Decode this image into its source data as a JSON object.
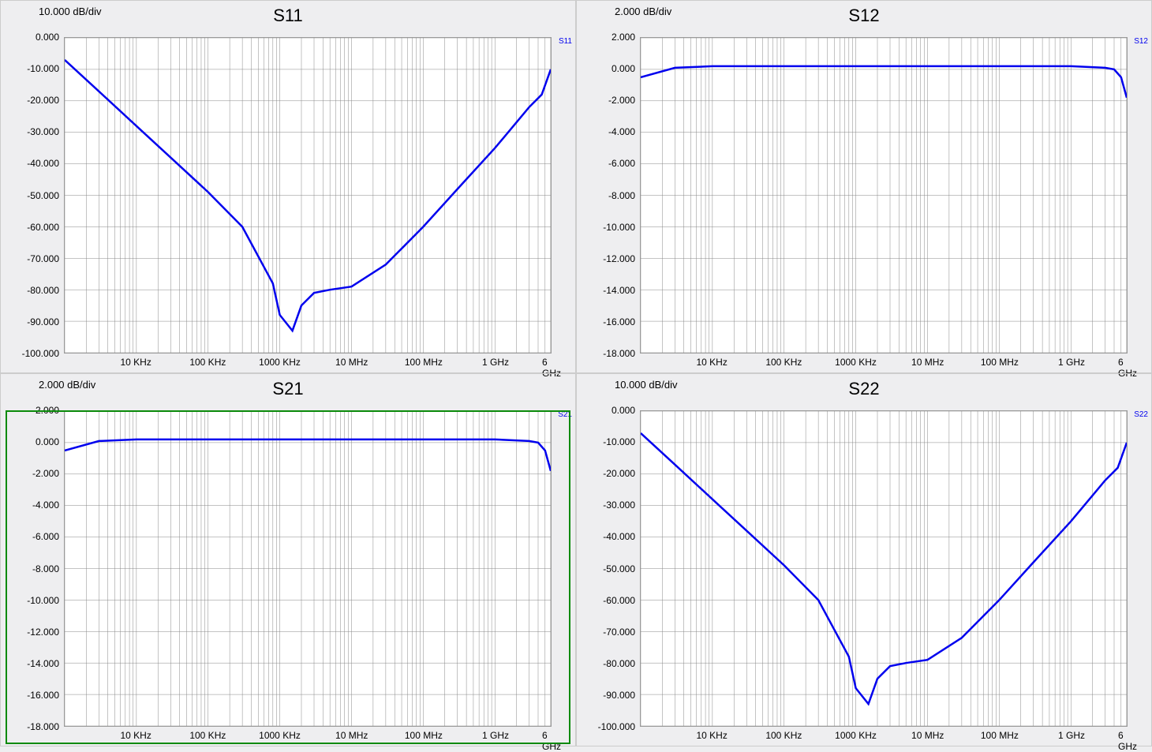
{
  "x_axis": {
    "type": "log",
    "min_hz": 1000,
    "max_hz": 6000000000,
    "tick_labels": [
      "10 KHz",
      "100 KHz",
      "1000 KHz",
      "10 MHz",
      "100 MHz",
      "1 GHz",
      "6 GHz"
    ],
    "tick_hz": [
      10000,
      100000,
      1000000,
      10000000,
      100000000,
      1000000000,
      6000000000
    ]
  },
  "y_axes": {
    "s11_s22": {
      "min": -100,
      "max": 0,
      "div": 10.0,
      "unit": "dB",
      "tick_labels": [
        "0.000",
        "-10.000",
        "-20.000",
        "-30.000",
        "-40.000",
        "-50.000",
        "-60.000",
        "-70.000",
        "-80.000",
        "-90.000",
        "-100.000"
      ]
    },
    "s12_s21": {
      "min": -18,
      "max": 2,
      "div": 2.0,
      "unit": "dB",
      "tick_labels": [
        "2.000",
        "0.000",
        "-2.000",
        "-4.000",
        "-6.000",
        "-8.000",
        "-10.000",
        "-12.000",
        "-14.000",
        "-16.000",
        "-18.000"
      ]
    }
  },
  "panels": [
    {
      "name": "S11",
      "db_per_div": "10.000 dB/div",
      "trace_label": "S11",
      "y_axis": "s11_s22",
      "selected": false
    },
    {
      "name": "S12",
      "db_per_div": "2.000 dB/div",
      "trace_label": "S12",
      "y_axis": "s12_s21",
      "selected": false
    },
    {
      "name": "S21",
      "db_per_div": "2.000 dB/div",
      "trace_label": "S21",
      "y_axis": "s12_s21",
      "selected": true
    },
    {
      "name": "S22",
      "db_per_div": "10.000 dB/div",
      "trace_label": "S22",
      "y_axis": "s11_s22",
      "selected": false
    }
  ],
  "chart_data": [
    {
      "name": "S11",
      "type": "line",
      "x_scale": "log",
      "title": "S11",
      "xlabel": "",
      "ylabel": "",
      "ylim": [
        -100,
        0
      ],
      "x_hz_approx": [
        1000,
        3000,
        10000,
        30000,
        100000,
        300000,
        800000,
        1000000,
        1500000,
        2000000,
        3000000,
        5000000,
        10000000,
        30000000,
        100000000,
        300000000,
        1000000000,
        3000000000,
        4500000000,
        6000000000
      ],
      "y_db_approx": [
        -7,
        -17,
        -28,
        -38,
        -49,
        -60,
        -78,
        -88,
        -93,
        -85,
        -81,
        -80,
        -79,
        -72,
        -60,
        -48,
        -35,
        -22,
        -18,
        -10
      ]
    },
    {
      "name": "S12",
      "type": "line",
      "x_scale": "log",
      "title": "S12",
      "xlabel": "",
      "ylabel": "",
      "ylim": [
        -18,
        2
      ],
      "x_hz_approx": [
        1000,
        3000,
        10000,
        100000,
        1000000,
        10000000,
        100000000,
        1000000000,
        3000000000,
        4000000000,
        5000000000,
        6000000000
      ],
      "y_db_approx": [
        -0.5,
        0.1,
        0.2,
        0.2,
        0.2,
        0.2,
        0.2,
        0.2,
        0.1,
        0.0,
        -0.5,
        -1.8
      ]
    },
    {
      "name": "S21",
      "type": "line",
      "x_scale": "log",
      "title": "S21",
      "xlabel": "",
      "ylabel": "",
      "ylim": [
        -18,
        2
      ],
      "x_hz_approx": [
        1000,
        3000,
        10000,
        100000,
        1000000,
        10000000,
        100000000,
        1000000000,
        3000000000,
        4000000000,
        5000000000,
        6000000000
      ],
      "y_db_approx": [
        -0.5,
        0.1,
        0.2,
        0.2,
        0.2,
        0.2,
        0.2,
        0.2,
        0.1,
        0.0,
        -0.5,
        -1.8
      ]
    },
    {
      "name": "S22",
      "type": "line",
      "x_scale": "log",
      "title": "S22",
      "xlabel": "",
      "ylabel": "",
      "ylim": [
        -100,
        0
      ],
      "x_hz_approx": [
        1000,
        3000,
        10000,
        30000,
        100000,
        300000,
        800000,
        1000000,
        1500000,
        2000000,
        3000000,
        5000000,
        10000000,
        30000000,
        100000000,
        300000000,
        1000000000,
        3000000000,
        4500000000,
        6000000000
      ],
      "y_db_approx": [
        -7,
        -17,
        -28,
        -38,
        -49,
        -60,
        -78,
        -88,
        -93,
        -85,
        -81,
        -80,
        -79,
        -72,
        -60,
        -48,
        -35,
        -22,
        -18,
        -10
      ]
    }
  ]
}
